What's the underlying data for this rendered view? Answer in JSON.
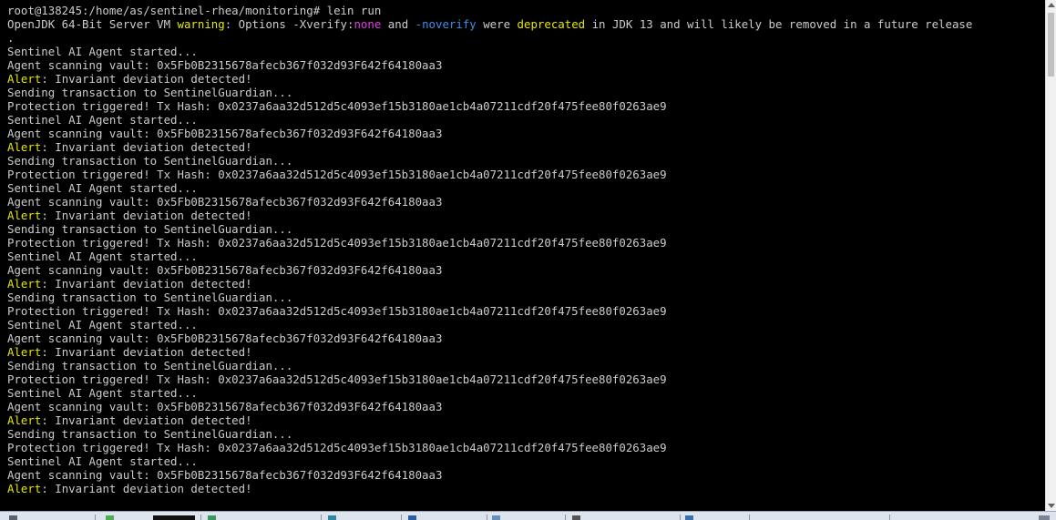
{
  "terminal": {
    "prompt": "root@138245:/home/as/sentinel-rhea/monitoring# lein run",
    "jdk_warning": {
      "prefix": "OpenJDK 64-Bit Server VM ",
      "warning_word": "warning",
      "mid1": ": Options -Xverify:",
      "none_word": "none",
      "mid2": " and ",
      "noverify_word": "-noverify",
      "mid3": " were ",
      "deprecated_word": "deprecated",
      "suffix": " in JDK 13 and will likely be removed in a future release",
      "wrap": "."
    },
    "cycle": {
      "started": "Sentinel AI Agent started...",
      "scanning": "Agent scanning vault: 0x5Fb0B2315678afecb367f032d93F642f64180aa3",
      "alert_word": "Alert",
      "alert_rest": ": Invariant deviation detected!",
      "sending": "Sending transaction to SentinelGuardian...",
      "protection": "Protection triggered! Tx Hash: 0x0237a6aa32d512d5c4093ef15b3180ae1cb4a07211cdf20f475fee80f0263ae9"
    }
  },
  "colors": {
    "background": "#000000",
    "text": "#cccccc",
    "warning": "#e5e510",
    "magenta": "#e040e0",
    "cyan": "#3b8eea",
    "alert": "#e5e510"
  }
}
